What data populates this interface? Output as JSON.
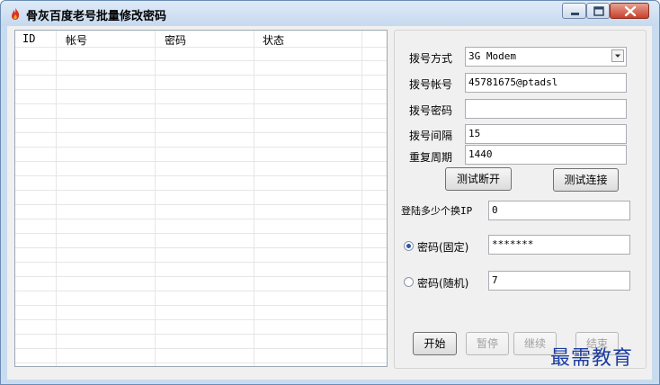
{
  "window": {
    "title": "骨灰百度老号批量修改密码",
    "icon": "flame-icon"
  },
  "list": {
    "columns": [
      "ID",
      "帐号",
      "密码",
      "状态"
    ],
    "rows": []
  },
  "dial": {
    "method_label": "拨号方式",
    "method_value": "3G Modem",
    "account_label": "拨号帐号",
    "account_value": "45781675@ptadsl",
    "password_label": "拨号密码",
    "password_value": "",
    "interval_label": "拨号间隔",
    "interval_value": "15",
    "period_label": "重复周期",
    "period_value": "1440",
    "test_disconnect_label": "测试断开",
    "test_connect_label": "测试连接"
  },
  "ip": {
    "label": "登陆多少个换IP",
    "value": "0"
  },
  "password": {
    "fixed_label": "密码(固定)",
    "fixed_value": "*******",
    "fixed_checked": true,
    "random_label": "密码(随机)",
    "random_value": "7"
  },
  "controls": {
    "start_label": "开始",
    "pause_label": "暂停",
    "continue_label": "继续",
    "end_label": "结束"
  },
  "watermark": "最需教育",
  "colors": {
    "title_bar": "#c6d9ef",
    "close_button": "#c7402a",
    "watermark": "#1d3d9e"
  }
}
